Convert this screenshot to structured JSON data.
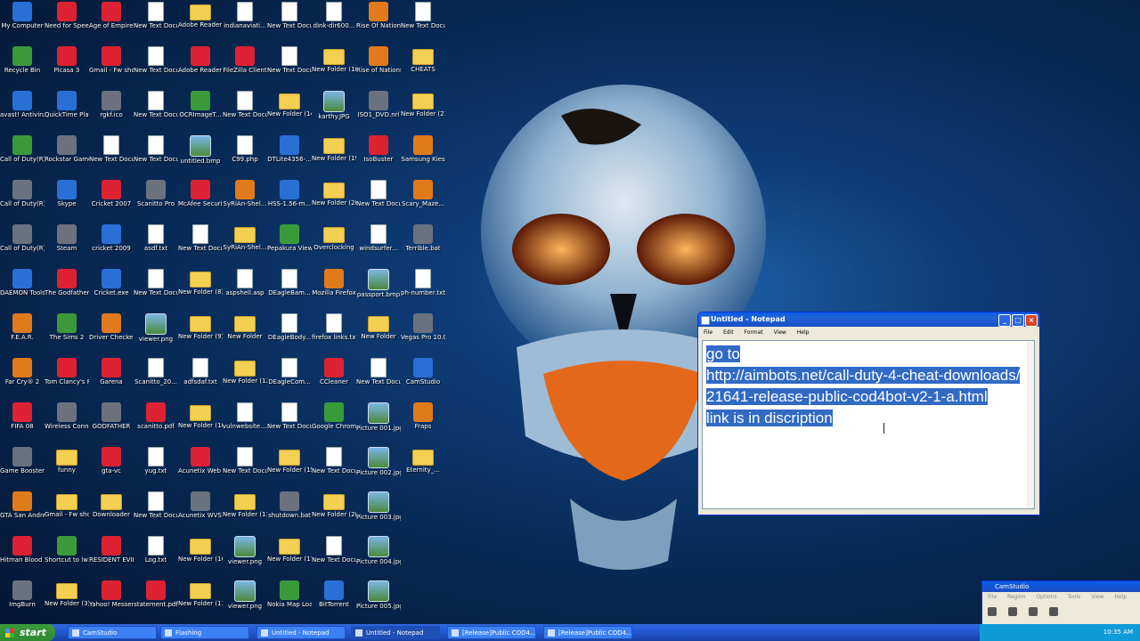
{
  "desktop_icons": [
    {
      "label": "My Computer",
      "kind": "g-blue",
      "col": 0,
      "row": 0
    },
    {
      "label": "Need for Speed™ M...",
      "kind": "g-app",
      "col": 1,
      "row": 0
    },
    {
      "label": "Age of Empires III",
      "kind": "g-app",
      "col": 2,
      "row": 0
    },
    {
      "label": "New Text Docum...",
      "kind": "g-file",
      "col": 3,
      "row": 0
    },
    {
      "label": "Adobe Reader 9 Installer",
      "kind": "g-folder",
      "col": 4,
      "row": 0
    },
    {
      "label": "indianaviati...",
      "kind": "g-file",
      "col": 5,
      "row": 0
    },
    {
      "label": "New Text Docum...",
      "kind": "g-file",
      "col": 6,
      "row": 0
    },
    {
      "label": "dink-dir600...",
      "kind": "g-file",
      "col": 7,
      "row": 0
    },
    {
      "label": "Rise Of Nations",
      "kind": "g-orange",
      "col": 8,
      "row": 0
    },
    {
      "label": "New Text Docum...",
      "kind": "g-file",
      "col": 9,
      "row": 0
    },
    {
      "label": "Recycle Bin",
      "kind": "g-green",
      "col": 0,
      "row": 1
    },
    {
      "label": "Picasa 3",
      "kind": "g-app",
      "col": 1,
      "row": 1
    },
    {
      "label": "Gmail - Fw shooting s...",
      "kind": "g-app",
      "col": 2,
      "row": 1
    },
    {
      "label": "New Text Docum...",
      "kind": "g-file",
      "col": 3,
      "row": 1
    },
    {
      "label": "Adobe Reader 9",
      "kind": "g-app",
      "col": 4,
      "row": 1
    },
    {
      "label": "FileZilla Client",
      "kind": "g-app",
      "col": 5,
      "row": 1
    },
    {
      "label": "New Text Docum...",
      "kind": "g-file",
      "col": 6,
      "row": 1
    },
    {
      "label": "New Folder (18)",
      "kind": "g-folder",
      "col": 7,
      "row": 1
    },
    {
      "label": "Rise of Nations T...",
      "kind": "g-orange",
      "col": 8,
      "row": 1
    },
    {
      "label": "CHEATS",
      "kind": "g-folder",
      "col": 9,
      "row": 1
    },
    {
      "label": "avast! Antivirus",
      "kind": "g-blue",
      "col": 0,
      "row": 2
    },
    {
      "label": "QuickTime Player",
      "kind": "g-blue",
      "col": 1,
      "row": 2
    },
    {
      "label": "rgkf.ico",
      "kind": "g-gray",
      "col": 2,
      "row": 2
    },
    {
      "label": "New Text Docum...",
      "kind": "g-file",
      "col": 3,
      "row": 2
    },
    {
      "label": "OCRImageT...",
      "kind": "g-green",
      "col": 4,
      "row": 2
    },
    {
      "label": "New Text Docum...",
      "kind": "g-file",
      "col": 5,
      "row": 2
    },
    {
      "label": "New Folder (14)",
      "kind": "g-folder",
      "col": 6,
      "row": 2
    },
    {
      "label": "karthy.JPG",
      "kind": "g-img",
      "col": 7,
      "row": 2
    },
    {
      "label": "ISO1_DVD.nrl",
      "kind": "g-gray",
      "col": 8,
      "row": 2
    },
    {
      "label": "New Folder (21)",
      "kind": "g-folder",
      "col": 9,
      "row": 2
    },
    {
      "label": "Call of Duty(R) 4 - Modern ...",
      "kind": "g-green",
      "col": 0,
      "row": 3
    },
    {
      "label": "Rockstar Games So...",
      "kind": "g-gray",
      "col": 1,
      "row": 3
    },
    {
      "label": "New Text Docum...",
      "kind": "g-file",
      "col": 2,
      "row": 3
    },
    {
      "label": "New Text Docum...",
      "kind": "g-file",
      "col": 3,
      "row": 3
    },
    {
      "label": "untitled.bmp",
      "kind": "g-img",
      "col": 4,
      "row": 3
    },
    {
      "label": "C99.php",
      "kind": "g-file",
      "col": 5,
      "row": 3
    },
    {
      "label": "DTLite4356-...",
      "kind": "g-blue",
      "col": 6,
      "row": 3
    },
    {
      "label": "New Folder (19)",
      "kind": "g-folder",
      "col": 7,
      "row": 3
    },
    {
      "label": "IsoBuster",
      "kind": "g-app",
      "col": 8,
      "row": 3
    },
    {
      "label": "Samsung Kies",
      "kind": "g-orange",
      "col": 9,
      "row": 3
    },
    {
      "label": "Call of Duty(R) - World at ...",
      "kind": "g-gray",
      "col": 0,
      "row": 4
    },
    {
      "label": "Skype",
      "kind": "g-blue",
      "col": 1,
      "row": 4
    },
    {
      "label": "Cricket 2007",
      "kind": "g-app",
      "col": 2,
      "row": 4
    },
    {
      "label": "Scanitto Pro",
      "kind": "g-gray",
      "col": 3,
      "row": 4
    },
    {
      "label": "McAfee Security Sc...",
      "kind": "g-app",
      "col": 4,
      "row": 4
    },
    {
      "label": "SyRiAn-Shel...",
      "kind": "g-orange",
      "col": 5,
      "row": 4
    },
    {
      "label": "HSS-1.56-m...",
      "kind": "g-blue",
      "col": 6,
      "row": 4
    },
    {
      "label": "New Folder (20)(2)",
      "kind": "g-folder",
      "col": 7,
      "row": 4
    },
    {
      "label": "New Text Docum...",
      "kind": "g-file",
      "col": 8,
      "row": 4
    },
    {
      "label": "Scary_Maze...",
      "kind": "g-orange",
      "col": 9,
      "row": 4
    },
    {
      "label": "Call of Duty(R) - World at ...",
      "kind": "g-gray",
      "col": 0,
      "row": 5
    },
    {
      "label": "Steam",
      "kind": "g-gray",
      "col": 1,
      "row": 5
    },
    {
      "label": "cricket 2009",
      "kind": "g-blue",
      "col": 2,
      "row": 5
    },
    {
      "label": "asdf.txt",
      "kind": "g-file",
      "col": 3,
      "row": 5
    },
    {
      "label": "New Text Docum...",
      "kind": "g-file",
      "col": 4,
      "row": 5
    },
    {
      "label": "SyRiAn-Shel...",
      "kind": "g-folder",
      "col": 5,
      "row": 5
    },
    {
      "label": "Pepakura Viewer 3",
      "kind": "g-green",
      "col": 6,
      "row": 5
    },
    {
      "label": "Overclocking",
      "kind": "g-folder",
      "col": 7,
      "row": 5
    },
    {
      "label": "windsurfer...",
      "kind": "g-file",
      "col": 8,
      "row": 5
    },
    {
      "label": "Terrible.bat",
      "kind": "g-gray",
      "col": 9,
      "row": 5
    },
    {
      "label": "DAEMON Tools Lite",
      "kind": "g-blue",
      "col": 0,
      "row": 6
    },
    {
      "label": "The Godfather™ II",
      "kind": "g-app",
      "col": 1,
      "row": 6
    },
    {
      "label": "Cricket.exe",
      "kind": "g-blue",
      "col": 2,
      "row": 6
    },
    {
      "label": "New Text Docum...",
      "kind": "g-file",
      "col": 3,
      "row": 6
    },
    {
      "label": "New Folder (8)",
      "kind": "g-folder",
      "col": 4,
      "row": 6
    },
    {
      "label": "aspshell.asp",
      "kind": "g-file",
      "col": 5,
      "row": 6
    },
    {
      "label": "DEagleBam...",
      "kind": "g-file",
      "col": 6,
      "row": 6
    },
    {
      "label": "Mozilla Firefox",
      "kind": "g-orange",
      "col": 7,
      "row": 6
    },
    {
      "label": "passport.bmp",
      "kind": "g-img",
      "col": 8,
      "row": 6
    },
    {
      "label": "ph-number.txt",
      "kind": "g-file",
      "col": 9,
      "row": 6
    },
    {
      "label": "F.E.A.R.",
      "kind": "g-orange",
      "col": 0,
      "row": 7
    },
    {
      "label": "The Sims 2",
      "kind": "g-green",
      "col": 1,
      "row": 7
    },
    {
      "label": "Driver Checker",
      "kind": "g-orange",
      "col": 2,
      "row": 7
    },
    {
      "label": "viewer.png",
      "kind": "g-img",
      "col": 3,
      "row": 7
    },
    {
      "label": "New Folder (9)",
      "kind": "g-folder",
      "col": 4,
      "row": 7
    },
    {
      "label": "New Folder",
      "kind": "g-folder",
      "col": 5,
      "row": 7
    },
    {
      "label": "DEagleBody...",
      "kind": "g-file",
      "col": 6,
      "row": 7
    },
    {
      "label": "firefox links.txt",
      "kind": "g-file",
      "col": 7,
      "row": 7
    },
    {
      "label": "New Folder",
      "kind": "g-folder",
      "col": 8,
      "row": 7
    },
    {
      "label": "Vegas Pro 10.0",
      "kind": "g-gray",
      "col": 9,
      "row": 7
    },
    {
      "label": "Far Cry® 2",
      "kind": "g-orange",
      "col": 0,
      "row": 8
    },
    {
      "label": "Tom Clancy's Rainbow S...",
      "kind": "g-app",
      "col": 1,
      "row": 8
    },
    {
      "label": "Garena",
      "kind": "g-app",
      "col": 2,
      "row": 8
    },
    {
      "label": "Scanitto_20...",
      "kind": "g-file",
      "col": 3,
      "row": 8
    },
    {
      "label": "adfsdaf.txt",
      "kind": "g-file",
      "col": 4,
      "row": 8
    },
    {
      "label": "New Folder (12)",
      "kind": "g-folder",
      "col": 5,
      "row": 8
    },
    {
      "label": "DEagleCom...",
      "kind": "g-file",
      "col": 6,
      "row": 8
    },
    {
      "label": "CCleaner",
      "kind": "g-app",
      "col": 7,
      "row": 8
    },
    {
      "label": "New Text Docum...",
      "kind": "g-file",
      "col": 8,
      "row": 8
    },
    {
      "label": "CamStudio",
      "kind": "g-blue",
      "col": 9,
      "row": 8
    },
    {
      "label": "FIFA 08",
      "kind": "g-app",
      "col": 0,
      "row": 9
    },
    {
      "label": "Wireless Connect...",
      "kind": "g-gray",
      "col": 1,
      "row": 9
    },
    {
      "label": "GODFATHER",
      "kind": "g-gray",
      "col": 2,
      "row": 9
    },
    {
      "label": "scanitto.pdf",
      "kind": "g-app",
      "col": 3,
      "row": 9
    },
    {
      "label": "New Folder (10)",
      "kind": "g-folder",
      "col": 4,
      "row": 9
    },
    {
      "label": "vulnwebsite....",
      "kind": "g-file",
      "col": 5,
      "row": 9
    },
    {
      "label": "New Text Docum...",
      "kind": "g-file",
      "col": 6,
      "row": 9
    },
    {
      "label": "Google Chrome",
      "kind": "g-green",
      "col": 7,
      "row": 9
    },
    {
      "label": "Picture 001.jpg",
      "kind": "g-img",
      "col": 8,
      "row": 9
    },
    {
      "label": "Fraps",
      "kind": "g-orange",
      "col": 9,
      "row": 9
    },
    {
      "label": "Game Booster",
      "kind": "g-gray",
      "col": 0,
      "row": 10
    },
    {
      "label": "funny",
      "kind": "g-folder",
      "col": 1,
      "row": 10
    },
    {
      "label": "gta-vc",
      "kind": "g-app",
      "col": 2,
      "row": 10
    },
    {
      "label": "yug.txt",
      "kind": "g-file",
      "col": 3,
      "row": 10
    },
    {
      "label": "Acunetix Web Vulnerabilit...",
      "kind": "g-app",
      "col": 4,
      "row": 10
    },
    {
      "label": "New Text Docum...",
      "kind": "g-file",
      "col": 5,
      "row": 10
    },
    {
      "label": "New Folder (15)",
      "kind": "g-folder",
      "col": 6,
      "row": 10
    },
    {
      "label": "New Text Document.txt",
      "kind": "g-file",
      "col": 7,
      "row": 10
    },
    {
      "label": "Picture 002.jpg",
      "kind": "g-img",
      "col": 8,
      "row": 10
    },
    {
      "label": "Eternity_...",
      "kind": "g-folder",
      "col": 9,
      "row": 10
    },
    {
      "label": "GTA San Andreas",
      "kind": "g-orange",
      "col": 0,
      "row": 11
    },
    {
      "label": "Gmail - Fw shooting s...",
      "kind": "g-folder",
      "col": 1,
      "row": 11
    },
    {
      "label": "Downloader",
      "kind": "g-folder",
      "col": 2,
      "row": 11
    },
    {
      "label": "New Text Docum...",
      "kind": "g-file",
      "col": 3,
      "row": 11
    },
    {
      "label": "Acunetix WVS Reporter 6",
      "kind": "g-gray",
      "col": 4,
      "row": 11
    },
    {
      "label": "New Folder (13)",
      "kind": "g-folder",
      "col": 5,
      "row": 11
    },
    {
      "label": "shutdown.bat",
      "kind": "g-gray",
      "col": 6,
      "row": 11
    },
    {
      "label": "New Folder (20)",
      "kind": "g-folder",
      "col": 7,
      "row": 11
    },
    {
      "label": "Picture 003.jpg",
      "kind": "g-img",
      "col": 8,
      "row": 11
    },
    {
      "label": "Hitman Blood Money",
      "kind": "g-app",
      "col": 0,
      "row": 12
    },
    {
      "label": "Shortcut to lw3mp.exe",
      "kind": "g-green",
      "col": 1,
      "row": 12
    },
    {
      "label": "RESIDENT EVIL 5",
      "kind": "g-app",
      "col": 2,
      "row": 12
    },
    {
      "label": "Log.txt",
      "kind": "g-file",
      "col": 3,
      "row": 12
    },
    {
      "label": "New Folder (16)",
      "kind": "g-folder",
      "col": 4,
      "row": 12
    },
    {
      "label": "viewer.png",
      "kind": "g-img",
      "col": 5,
      "row": 12
    },
    {
      "label": "New Folder (17)",
      "kind": "g-folder",
      "col": 6,
      "row": 12
    },
    {
      "label": "New Text Docum...",
      "kind": "g-file",
      "col": 7,
      "row": 12
    },
    {
      "label": "Picture 004.jpg",
      "kind": "g-img",
      "col": 8,
      "row": 12
    },
    {
      "label": "ImgBurn",
      "kind": "g-gray",
      "col": 0,
      "row": 13
    },
    {
      "label": "New Folder (3)",
      "kind": "g-folder",
      "col": 1,
      "row": 13
    },
    {
      "label": "Yahoo! Messenger",
      "kind": "g-app",
      "col": 2,
      "row": 13
    },
    {
      "label": "statement.pdf",
      "kind": "g-app",
      "col": 3,
      "row": 13
    },
    {
      "label": "New Folder (11)",
      "kind": "g-folder",
      "col": 4,
      "row": 13
    },
    {
      "label": "viewer.png",
      "kind": "g-img",
      "col": 5,
      "row": 13
    },
    {
      "label": "Nokia Map Loader",
      "kind": "g-green",
      "col": 6,
      "row": 13
    },
    {
      "label": "BitTorrent",
      "kind": "g-blue",
      "col": 7,
      "row": 13
    },
    {
      "label": "Picture 005.jpg",
      "kind": "g-img",
      "col": 8,
      "row": 13
    }
  ],
  "notepad": {
    "title": "Untitled - Notepad",
    "menu": [
      "File",
      "Edit",
      "Format",
      "View",
      "Help"
    ],
    "lines": [
      "go to",
      "http://aimbots.net/call-duty-4-cheat-downloads/21641-release-public-cod4bot-v2-1-a.html",
      "link is in discription"
    ],
    "min_label": "_",
    "max_label": "□",
    "close_label": "×"
  },
  "camstudio": {
    "title": "CamStudio",
    "menu": [
      "File",
      "Region",
      "Options",
      "Tools",
      "View",
      "Help"
    ]
  },
  "taskbar": {
    "start_label": "start",
    "tasks": [
      "CamStudio",
      "Flashing",
      "Untitled - Notepad",
      "Untitled - Notepad",
      "[Release]Public COD4...",
      "[Release]Public COD4..."
    ],
    "active_index": 3,
    "clock": "10:35 AM"
  },
  "colors": {
    "selection": "#316ac5",
    "titlebar": "#0a5de6",
    "taskbar": "#245edc",
    "start": "#3c9a3c"
  }
}
